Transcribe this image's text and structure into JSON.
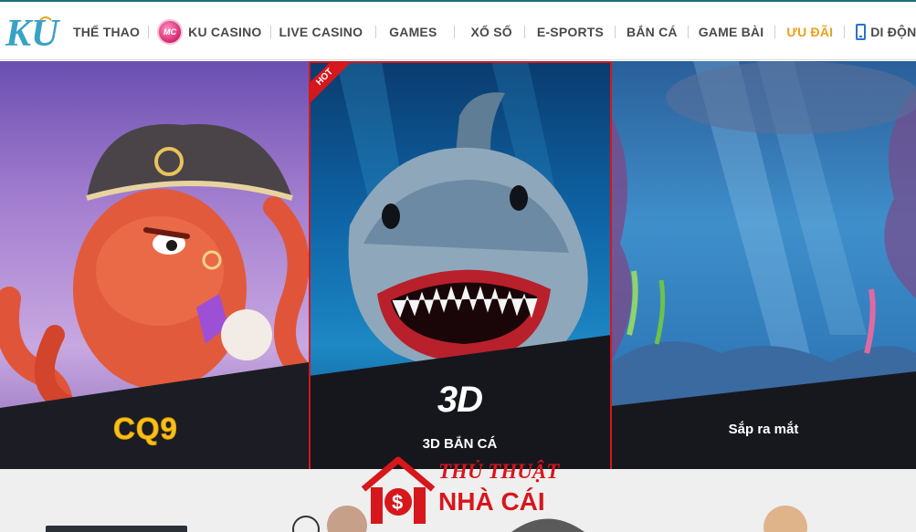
{
  "logo": {
    "text": "KU"
  },
  "nav": {
    "items": [
      {
        "label": "THỂ THAO"
      },
      {
        "label": "KU CASINO",
        "badge": "MC"
      },
      {
        "label": "LIVE CASINO"
      },
      {
        "label": "GAMES"
      },
      {
        "label": "XỔ SỐ"
      },
      {
        "label": "E-SPORTS"
      },
      {
        "label": "BẮN CÁ"
      },
      {
        "label": "GAME BÀI"
      },
      {
        "label": "ƯU ĐÃI"
      },
      {
        "label": "DI ĐỘNG"
      }
    ]
  },
  "panels": {
    "cq9": {
      "logo": "CQ9"
    },
    "fishing3d": {
      "ribbon": "HOT",
      "logo": "3D",
      "caption": "3D BẮN CÁ"
    },
    "coming": {
      "caption": "Sắp ra mắt"
    }
  },
  "watermark": {
    "line1": "THỦ THUẬT",
    "line2": "NHÀ CÁI"
  },
  "colors": {
    "accent_red": "#d6171c",
    "promo_orange": "#e8a11a",
    "nav_text": "#4a4a4a",
    "cq9_gold": "#f6c21c"
  },
  "icons": {
    "mobile": "phone-icon",
    "casino": "mc-badge-icon"
  }
}
